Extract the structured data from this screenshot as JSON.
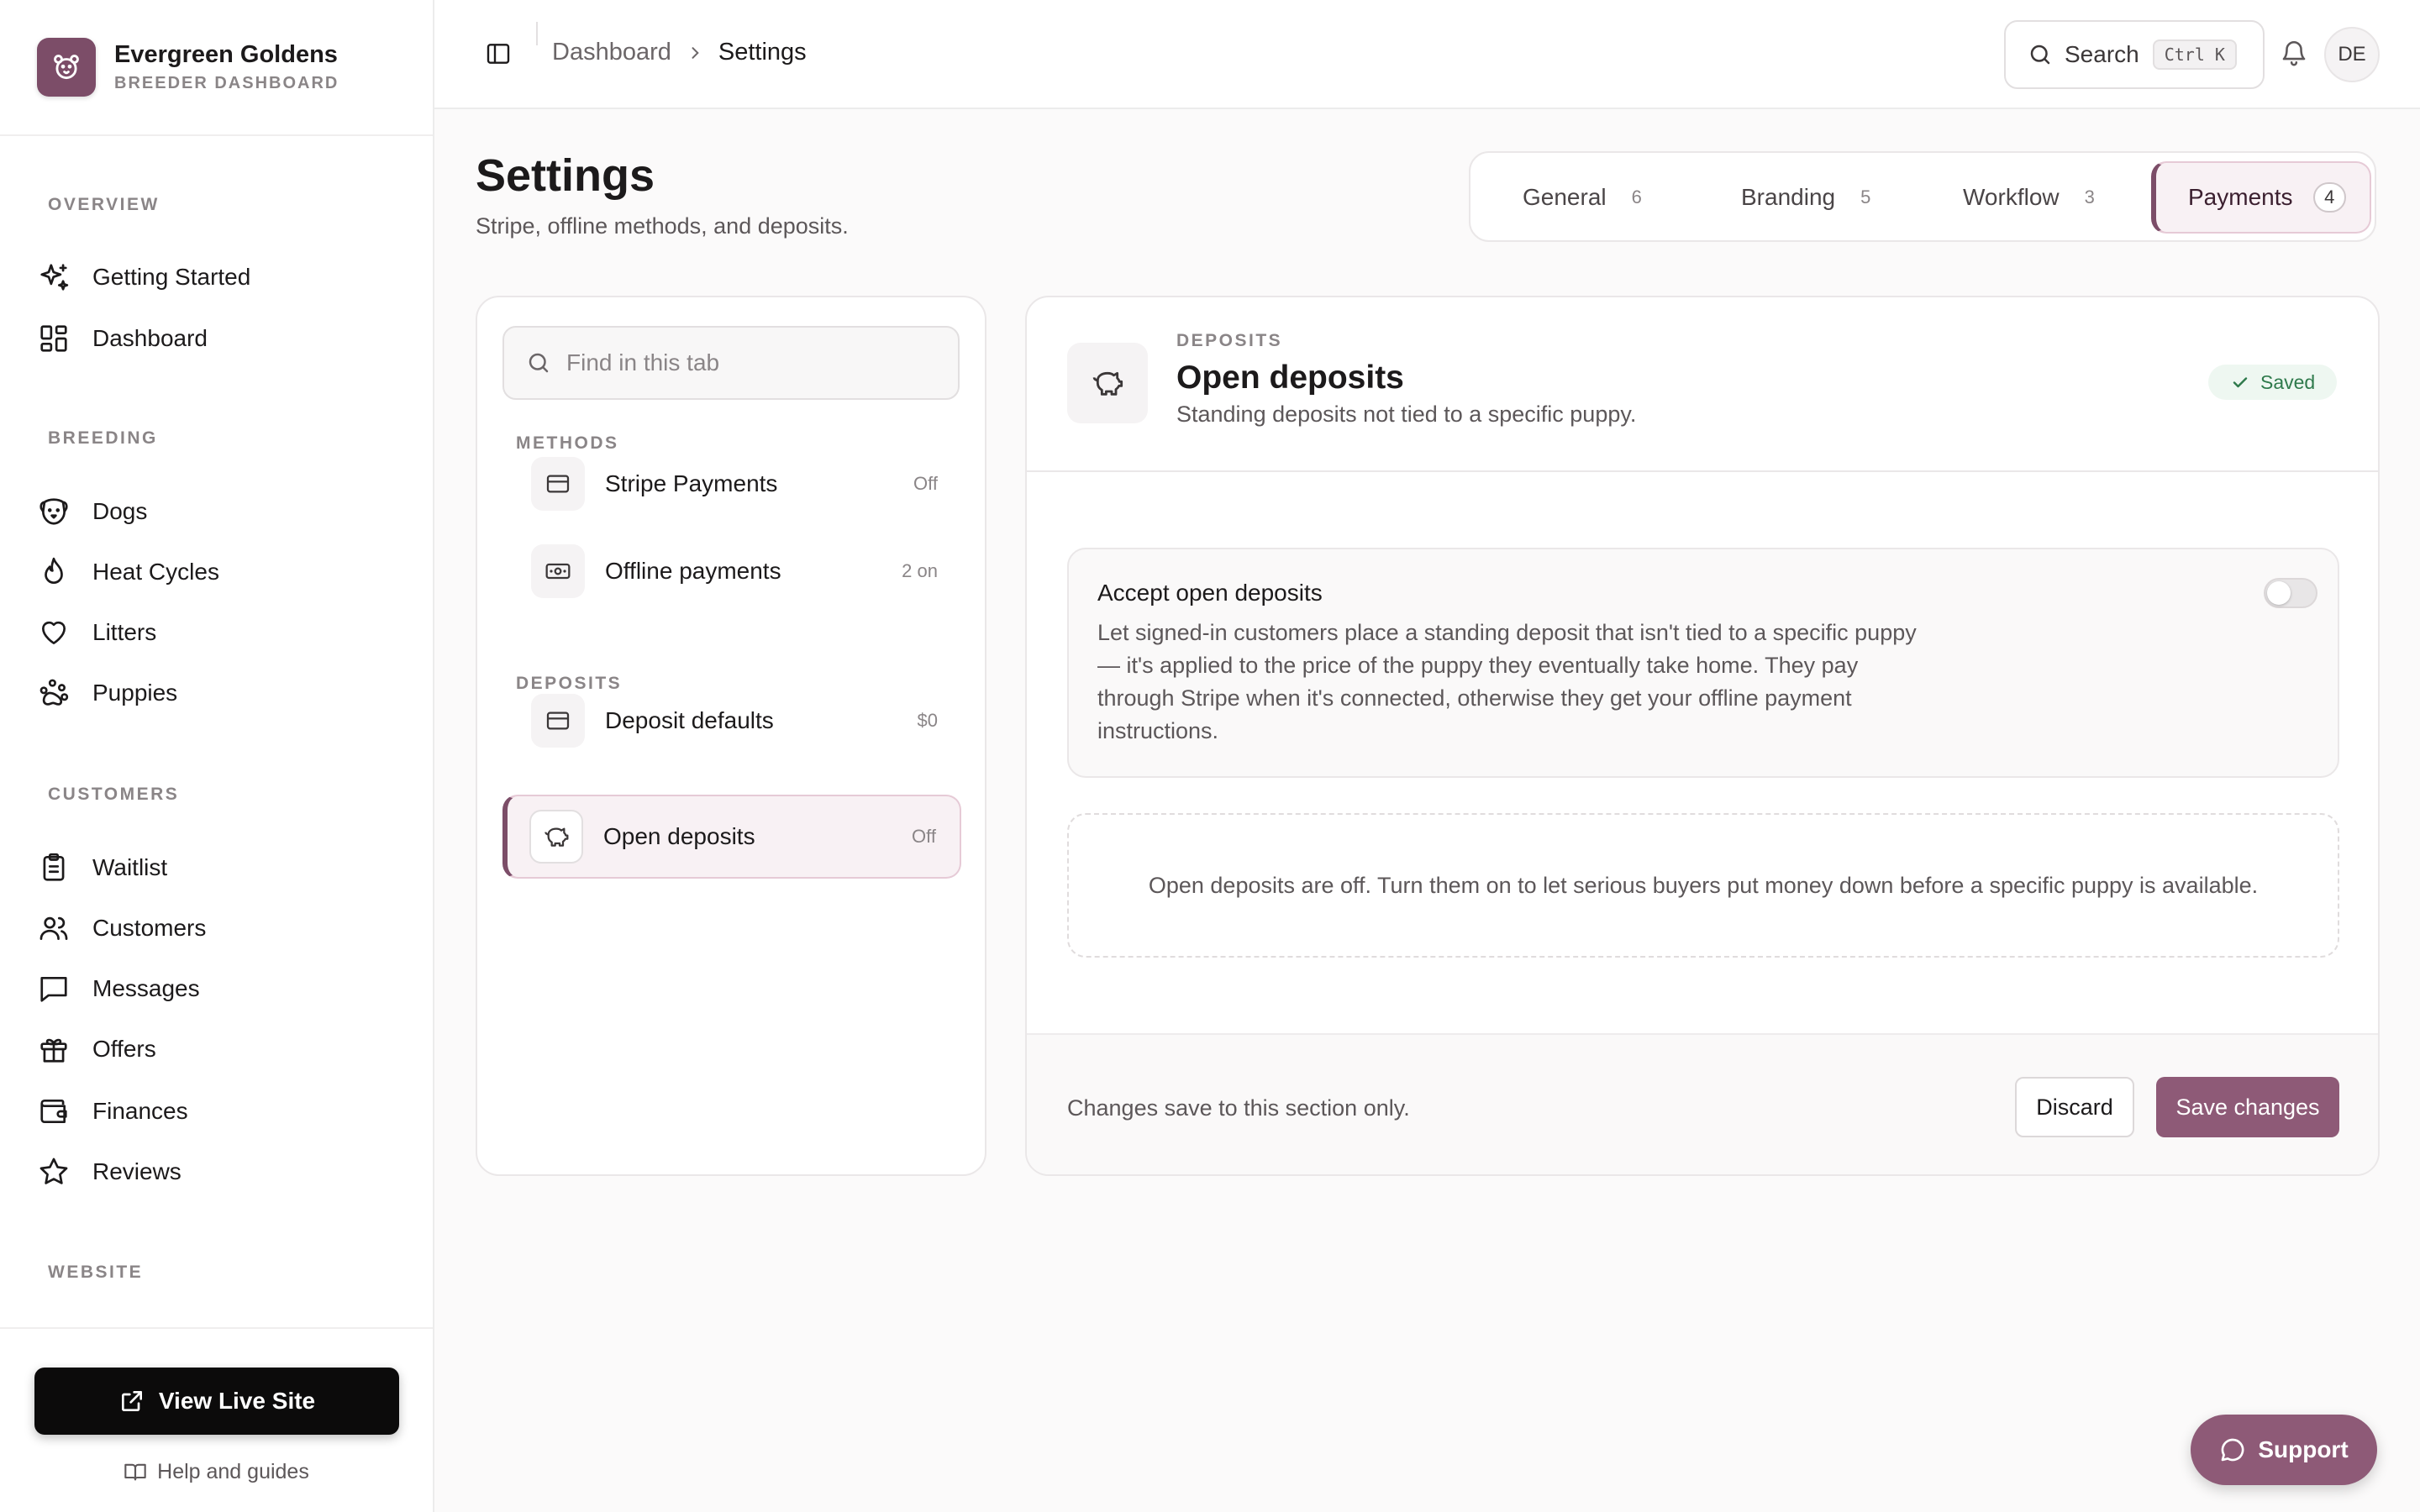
{
  "brand": {
    "name": "Evergreen Goldens",
    "subtitle": "BREEDER DASHBOARD",
    "logo_icon": "bear-face-icon",
    "accent": "#7c4d68"
  },
  "sidebar": {
    "sections": [
      {
        "label": "OVERVIEW",
        "items": [
          {
            "label": "Getting Started",
            "icon": "sparkles-icon"
          },
          {
            "label": "Dashboard",
            "icon": "grid-icon"
          }
        ]
      },
      {
        "label": "BREEDING",
        "items": [
          {
            "label": "Dogs",
            "icon": "dog-icon"
          },
          {
            "label": "Heat Cycles",
            "icon": "flame-icon"
          },
          {
            "label": "Litters",
            "icon": "heart-icon"
          },
          {
            "label": "Puppies",
            "icon": "paw-icon"
          }
        ]
      },
      {
        "label": "CUSTOMERS",
        "items": [
          {
            "label": "Waitlist",
            "icon": "clipboard-icon"
          },
          {
            "label": "Customers",
            "icon": "users-icon"
          },
          {
            "label": "Messages",
            "icon": "message-icon"
          },
          {
            "label": "Offers",
            "icon": "gift-icon"
          },
          {
            "label": "Finances",
            "icon": "wallet-icon"
          },
          {
            "label": "Reviews",
            "icon": "star-icon"
          }
        ]
      },
      {
        "label": "WEBSITE",
        "items": []
      }
    ],
    "live_site_label": "View Live Site",
    "help_label": "Help and guides"
  },
  "topbar": {
    "breadcrumb": {
      "parent": "Dashboard",
      "current": "Settings"
    },
    "search_label": "Search",
    "search_shortcut": "Ctrl K",
    "avatar_initials": "DE"
  },
  "page": {
    "title": "Settings",
    "subtitle": "Stripe, offline methods, and deposits."
  },
  "tabs": [
    {
      "label": "General",
      "count": "6",
      "active": false
    },
    {
      "label": "Branding",
      "count": "5",
      "active": false
    },
    {
      "label": "Workflow",
      "count": "3",
      "active": false
    },
    {
      "label": "Payments",
      "count": "4",
      "active": true
    }
  ],
  "list": {
    "find_placeholder": "Find in this tab",
    "groups": [
      {
        "label": "METHODS",
        "items": [
          {
            "name": "Stripe Payments",
            "meta": "Off",
            "icon": "credit-card-icon"
          },
          {
            "name": "Offline payments",
            "meta": "2 on",
            "icon": "banknote-icon"
          }
        ]
      },
      {
        "label": "DEPOSITS",
        "items": [
          {
            "name": "Deposit defaults",
            "meta": "$0",
            "icon": "credit-card-icon"
          },
          {
            "name": "Open deposits",
            "meta": "Off",
            "icon": "piggy-bank-icon",
            "active": true
          }
        ]
      }
    ]
  },
  "detail": {
    "eyebrow": "DEPOSITS",
    "title": "Open deposits",
    "subtitle": "Standing deposits not tied to a specific puppy.",
    "status": "Saved",
    "setting": {
      "title": "Accept open deposits",
      "description": "Let signed-in customers place a standing deposit that isn't tied to a specific puppy — it's applied to the price of the puppy they eventually take home. They pay through Stripe when it's connected, otherwise they get your offline payment instructions.",
      "enabled": false
    },
    "empty_note": "Open deposits are off. Turn them on to let serious buyers put money down before a specific puppy is available.",
    "footer_note": "Changes save to this section only.",
    "discard_label": "Discard",
    "save_label": "Save changes"
  },
  "support_label": "Support"
}
